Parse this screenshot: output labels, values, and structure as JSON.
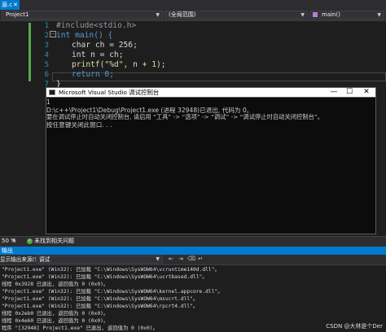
{
  "tabs": {
    "active_label": "源.c",
    "close_glyph": "✕"
  },
  "navbar": {
    "project": "Project1",
    "scope": "(全局范围)",
    "function": "main()"
  },
  "editor": {
    "line_numbers": [
      "1",
      "2",
      "3",
      "4",
      "5",
      "6",
      "7"
    ],
    "fold_glyph": "−",
    "lines": [
      "#include<stdio.h>",
      "int main() {",
      "char ch = 256;",
      "int n = ch;",
      "printf(\"%d\", n + 1);",
      "return 0;",
      "}"
    ]
  },
  "console": {
    "title": "Microsoft Visual Studio 调试控制台",
    "minimize": "—",
    "maximize": "☐",
    "close": "✕",
    "lines": [
      "1",
      "D:\\c++\\Project1\\Debug\\Project1.exe (进程 32948)已退出, 代码为 0。",
      "要在调试停止时自动关闭控制台, 请启用 “工具” -> “选项” -> “调试” -> “调试停止时自动关闭控制台”。",
      "按任意键关闭此窗口. . ."
    ]
  },
  "statusbar": {
    "zoom": "50 %",
    "issues": "未找到相关问题"
  },
  "output": {
    "title": "输出",
    "source_label": "显示输出来源(S):",
    "source_value": "调试",
    "lines": [
      "\"Project1.exe\" (Win32): 已加载 \"C:\\Windows\\SysWOW64\\vcruntime140d.dll\"。",
      "\"Project1.exe\" (Win32): 已加载 \"C:\\Windows\\SysWOW64\\ucrtbased.dll\"。",
      "线程 0x3928 已退出, 返回值为 0 (0x0)。",
      "\"Project1.exe\" (Win32): 已加载 \"C:\\Windows\\SysWOW64\\kernel.appcore.dll\"。",
      "\"Project1.exe\" (Win32): 已加载 \"C:\\Windows\\SysWOW64\\msvcrt.dll\"。",
      "\"Project1.exe\" (Win32): 已加载 \"C:\\Windows\\SysWOW64\\rpcrt4.dll\"。",
      "线程 0x2eb0 已退出, 返回值为 0 (0x0)。",
      "线程 0x4e60 已退出, 返回值为 0 (0x0)。",
      "程序 \"[32948] Project1.exe\" 已退出, 返回值为 0 (0x0)。"
    ]
  },
  "watermark": "CSDN @大林是个Der"
}
